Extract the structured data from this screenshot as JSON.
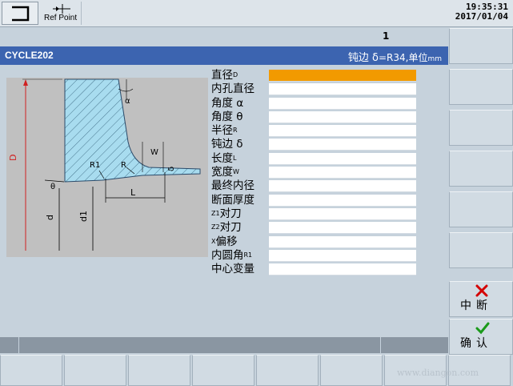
{
  "topbar": {
    "home_label": "",
    "refpoint_label": "Ref Point",
    "time": "19:35:31",
    "date": "2017/01/04"
  },
  "channel": {
    "number": "1"
  },
  "title": {
    "cycle": "CYCLE202",
    "info_prefix": "钝边 δ",
    "info_value": "=R34,单位",
    "info_unit": "mm"
  },
  "params": [
    {
      "label": "直径",
      "sup": "D",
      "active": true
    },
    {
      "label": "内孔直径",
      "sup": "",
      "active": false
    },
    {
      "label": "角度 α",
      "sup": "",
      "active": false
    },
    {
      "label": "角度 θ",
      "sup": "",
      "active": false
    },
    {
      "label": "半径",
      "sup": "R",
      "active": false
    },
    {
      "label": "钝边 δ",
      "sup": "",
      "active": false
    },
    {
      "label": "长度",
      "sup": "L",
      "active": false
    },
    {
      "label": "宽度",
      "sup": "W",
      "active": false
    },
    {
      "label": "最终内径",
      "sup": "",
      "active": false
    },
    {
      "label": "断面厚度",
      "sup": "",
      "active": false
    },
    {
      "label": "对刀",
      "pre": "Z1",
      "sup": "",
      "active": false
    },
    {
      "label": "对刀",
      "pre": "Z2",
      "sup": "",
      "active": false
    },
    {
      "label": "偏移",
      "pre": "X",
      "sup": "",
      "active": false
    },
    {
      "label": "内圆角",
      "sup": "R1",
      "active": false
    },
    {
      "label": "中心变量",
      "sup": "",
      "active": false
    }
  ],
  "drawing_labels": {
    "D": "D",
    "d": "d",
    "d1": "d1",
    "L": "L",
    "R": "R",
    "R1": "R1",
    "W": "W",
    "alpha": "α",
    "theta": "θ",
    "delta": "δ"
  },
  "softkeys": {
    "cancel_label": "中断",
    "ok_label": "确认"
  },
  "watermark": "www.diangon.com",
  "colors": {
    "title_bg": "#3c64b0",
    "active_field": "#f29a00",
    "cancel_icon": "#d40000",
    "ok_icon": "#1a9a1a"
  }
}
